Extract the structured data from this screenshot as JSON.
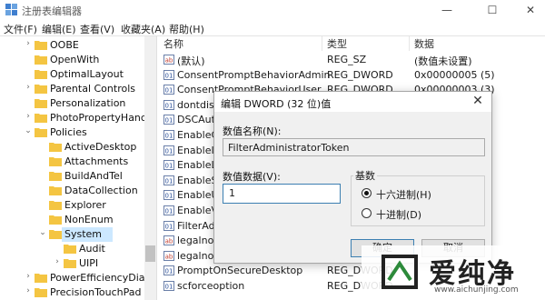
{
  "window": {
    "title": "注册表编辑器",
    "minimize": "—",
    "maximize": "☐",
    "close": "✕"
  },
  "menu": [
    "文件(F)",
    "编辑(E)",
    "查看(V)",
    "收藏夹(A)",
    "帮助(H)"
  ],
  "tree": {
    "items": [
      {
        "label": "OOBE",
        "level": 3,
        "expand": "›"
      },
      {
        "label": "OpenWith",
        "level": 3,
        "expand": ""
      },
      {
        "label": "OptimalLayout",
        "level": 3,
        "expand": ""
      },
      {
        "label": "Parental Controls",
        "level": 3,
        "expand": "›"
      },
      {
        "label": "Personalization",
        "level": 3,
        "expand": ""
      },
      {
        "label": "PhotoPropertyHanc",
        "level": 3,
        "expand": "›"
      },
      {
        "label": "Policies",
        "level": 3,
        "expand": "⌄"
      },
      {
        "label": "ActiveDesktop",
        "level": 4,
        "expand": ""
      },
      {
        "label": "Attachments",
        "level": 4,
        "expand": ""
      },
      {
        "label": "BuildAndTel",
        "level": 4,
        "expand": ""
      },
      {
        "label": "DataCollection",
        "level": 4,
        "expand": ""
      },
      {
        "label": "Explorer",
        "level": 4,
        "expand": ""
      },
      {
        "label": "NonEnum",
        "level": 4,
        "expand": ""
      },
      {
        "label": "System",
        "level": 4,
        "expand": "⌄",
        "selected": true
      },
      {
        "label": "Audit",
        "level": 5,
        "expand": ""
      },
      {
        "label": "UIPI",
        "level": 5,
        "expand": "›"
      },
      {
        "label": "PowerEfficiencyDiag",
        "level": 3,
        "expand": "›"
      },
      {
        "label": "PrecisionTouchPad",
        "level": 3,
        "expand": "›"
      }
    ]
  },
  "list": {
    "columns": [
      "名称",
      "类型",
      "数据"
    ],
    "rows": [
      {
        "icon": "string-value-icon",
        "name": "(默认)",
        "type": "REG_SZ",
        "data": "(数值未设置)"
      },
      {
        "icon": "binary-value-icon",
        "name": "ConsentPromptBehaviorAdmin",
        "type": "REG_DWORD",
        "data": "0x00000005 (5)"
      },
      {
        "icon": "binary-value-icon",
        "name": "ConsentPromptBehaviorUser",
        "type": "REG_DWORD",
        "data": "0x00000003 (3)"
      },
      {
        "icon": "binary-value-icon",
        "name": "dontdisplaylastusername",
        "type": "",
        "data": ""
      },
      {
        "icon": "binary-value-icon",
        "name": "DSCAutomationHostEnabled",
        "type": "",
        "data": ""
      },
      {
        "icon": "binary-value-icon",
        "name": "EnableCursorSuppression",
        "type": "",
        "data": ""
      },
      {
        "icon": "binary-value-icon",
        "name": "EnableInstallerDetection",
        "type": "",
        "data": ""
      },
      {
        "icon": "binary-value-icon",
        "name": "EnableLUA",
        "type": "",
        "data": ""
      },
      {
        "icon": "binary-value-icon",
        "name": "EnableSecureUIAPaths",
        "type": "",
        "data": ""
      },
      {
        "icon": "binary-value-icon",
        "name": "EnableUIADesktopToggle",
        "type": "",
        "data": ""
      },
      {
        "icon": "binary-value-icon",
        "name": "EnableVirtualization",
        "type": "",
        "data": ""
      },
      {
        "icon": "binary-value-icon",
        "name": "FilterAdministratorToken",
        "type": "",
        "data": ""
      },
      {
        "icon": "string-value-icon",
        "name": "legalnoticecaption",
        "type": "",
        "data": ""
      },
      {
        "icon": "string-value-icon",
        "name": "legalnoticetext",
        "type": "",
        "data": ""
      },
      {
        "icon": "binary-value-icon",
        "name": "PromptOnSecureDesktop",
        "type": "REG_DWORD",
        "data": ""
      },
      {
        "icon": "binary-value-icon",
        "name": "scforceoption",
        "type": "REG_DWORD",
        "data": ""
      }
    ]
  },
  "dialog": {
    "title": "编辑 DWORD (32 位)值",
    "close": "✕",
    "name_label": "数值名称(N):",
    "name_value": "FilterAdministratorToken",
    "data_label": "数值数据(V):",
    "data_value": "1",
    "base_label": "基数",
    "hex_label": "十六进制(H)",
    "dec_label": "十进制(D)",
    "base_selected": "hex",
    "ok_label": "确定",
    "cancel_label": "取消"
  },
  "watermark": {
    "brand": "爱纯净",
    "url": "www.aichunjing.com"
  },
  "colors": {
    "folder": "#f4c542",
    "selection": "#cce8ff",
    "accent": "#3c7fb1",
    "logo_green": "#2c8a3a"
  }
}
